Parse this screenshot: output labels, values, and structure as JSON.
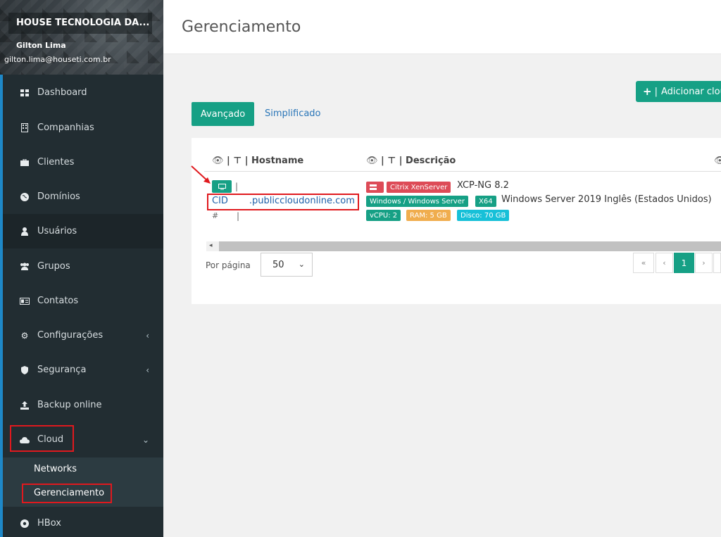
{
  "sidebar": {
    "company": "HOUSE TECNOLOGIA DA...",
    "user_name": "Gilton Lima",
    "user_email": "gilton.lima@houseti.com.br",
    "items": [
      {
        "label": "Dashboard",
        "icon": "dashboard-icon"
      },
      {
        "label": "Companhias",
        "icon": "building-icon"
      },
      {
        "label": "Clientes",
        "icon": "briefcase-icon"
      },
      {
        "label": "Domínios",
        "icon": "globe-icon"
      },
      {
        "label": "Usuários",
        "icon": "user-icon"
      },
      {
        "label": "Grupos",
        "icon": "users-icon"
      },
      {
        "label": "Contatos",
        "icon": "address-card-icon"
      },
      {
        "label": "Configurações",
        "icon": "gear-icon"
      },
      {
        "label": "Segurança",
        "icon": "shield-icon"
      },
      {
        "label": "Backup online",
        "icon": "upload-icon"
      },
      {
        "label": "Cloud",
        "icon": "cloud-icon"
      },
      {
        "label": "HBox",
        "icon": "hbox-icon"
      }
    ],
    "submenu": {
      "networks": "Networks",
      "gerenciamento": "Gerenciamento"
    }
  },
  "header": {
    "title": "Gerenciamento"
  },
  "toolbar": {
    "add_label": "Adicionar clou",
    "add_icon": "+"
  },
  "tabs": {
    "advanced": "Avançado",
    "simplified": "Simplificado"
  },
  "table": {
    "col_hostname": "Hostname",
    "col_descricao": "Descrição",
    "row": {
      "cid": "CID",
      "domain": ".publiccloudonline.com",
      "hash": "#",
      "badge_citrix": "Citrix XenServer",
      "platform": "XCP-NG 8.2",
      "badge_os": "Windows / Windows Server",
      "badge_arch": "X64",
      "os_name": "Windows Server 2019 Inglês (Estados Unidos)",
      "badge_vcpu": "vCPU: 2",
      "badge_ram": "RAM: 5 GB",
      "badge_disk": "Disco: 70 GB"
    }
  },
  "pagination": {
    "per_page_label": "Por página",
    "per_page_value": "50",
    "first": "«",
    "prev": "‹",
    "current": "1",
    "next": "›"
  },
  "colors": {
    "accent": "#16a085",
    "sidebar": "#222d32",
    "highlight": "#e0191e",
    "badge_red": "#dd4b57",
    "badge_orange": "#f0ad4e",
    "badge_cyan": "#17c0d8"
  }
}
